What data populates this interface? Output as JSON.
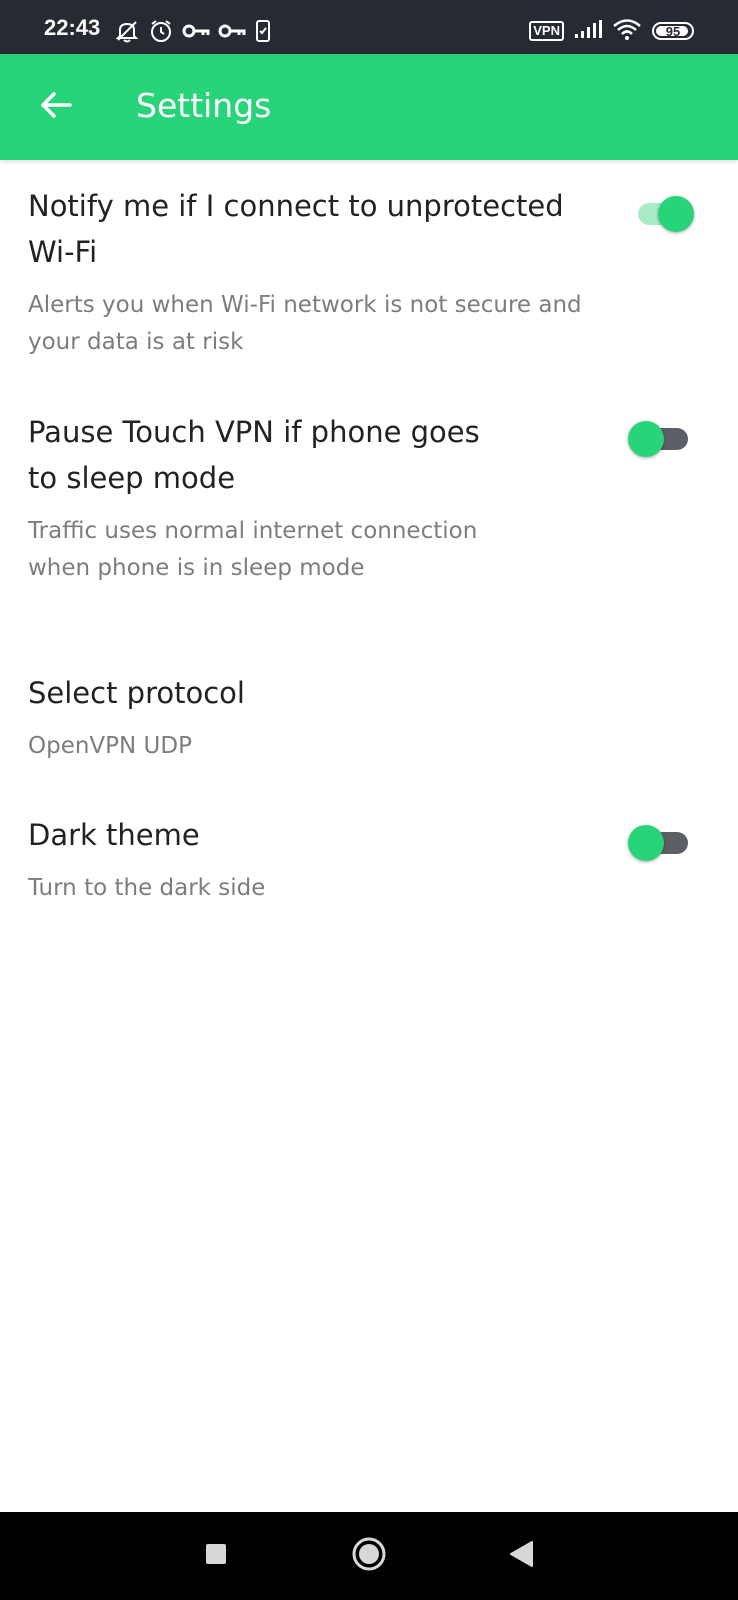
{
  "status_bar": {
    "time": "22:43",
    "vpn_label": "VPN",
    "battery_level": "95",
    "battery_fraction": 0.95,
    "icons_left": [
      "bell-off-icon",
      "alarm-icon",
      "key-icon",
      "key-icon",
      "phone-check-icon"
    ],
    "icons_right": [
      "vpn-icon",
      "signal-icon",
      "wifi-icon",
      "battery-icon"
    ]
  },
  "app_bar": {
    "title": "Settings",
    "back_icon": "arrow-left-icon",
    "background_color": "#27d47a"
  },
  "settings": [
    {
      "title": "Notify me if I connect to unprotected Wi-Fi",
      "description": "Alerts you when Wi-Fi network is not secure and your data is at risk",
      "toggle": true,
      "enabled": true
    },
    {
      "title": "Pause Touch VPN if phone goes to sleep mode",
      "description": "Traffic uses normal internet connection when phone is in sleep mode",
      "toggle": true,
      "enabled": false
    },
    {
      "title": "Select protocol",
      "description": "OpenVPN UDP",
      "toggle": false
    },
    {
      "title": "Dark theme",
      "description": "Turn to the dark side",
      "toggle": true,
      "enabled": false
    }
  ],
  "colors": {
    "accent": "#27d47a",
    "toggle_on_track": "#a8ebc6",
    "toggle_off_track": "#5d5f66",
    "text_primary": "#222222",
    "text_secondary": "#7d7d7d"
  },
  "nav_bar": {
    "icons": [
      "square-recents-icon",
      "circle-home-icon",
      "triangle-back-icon"
    ]
  }
}
